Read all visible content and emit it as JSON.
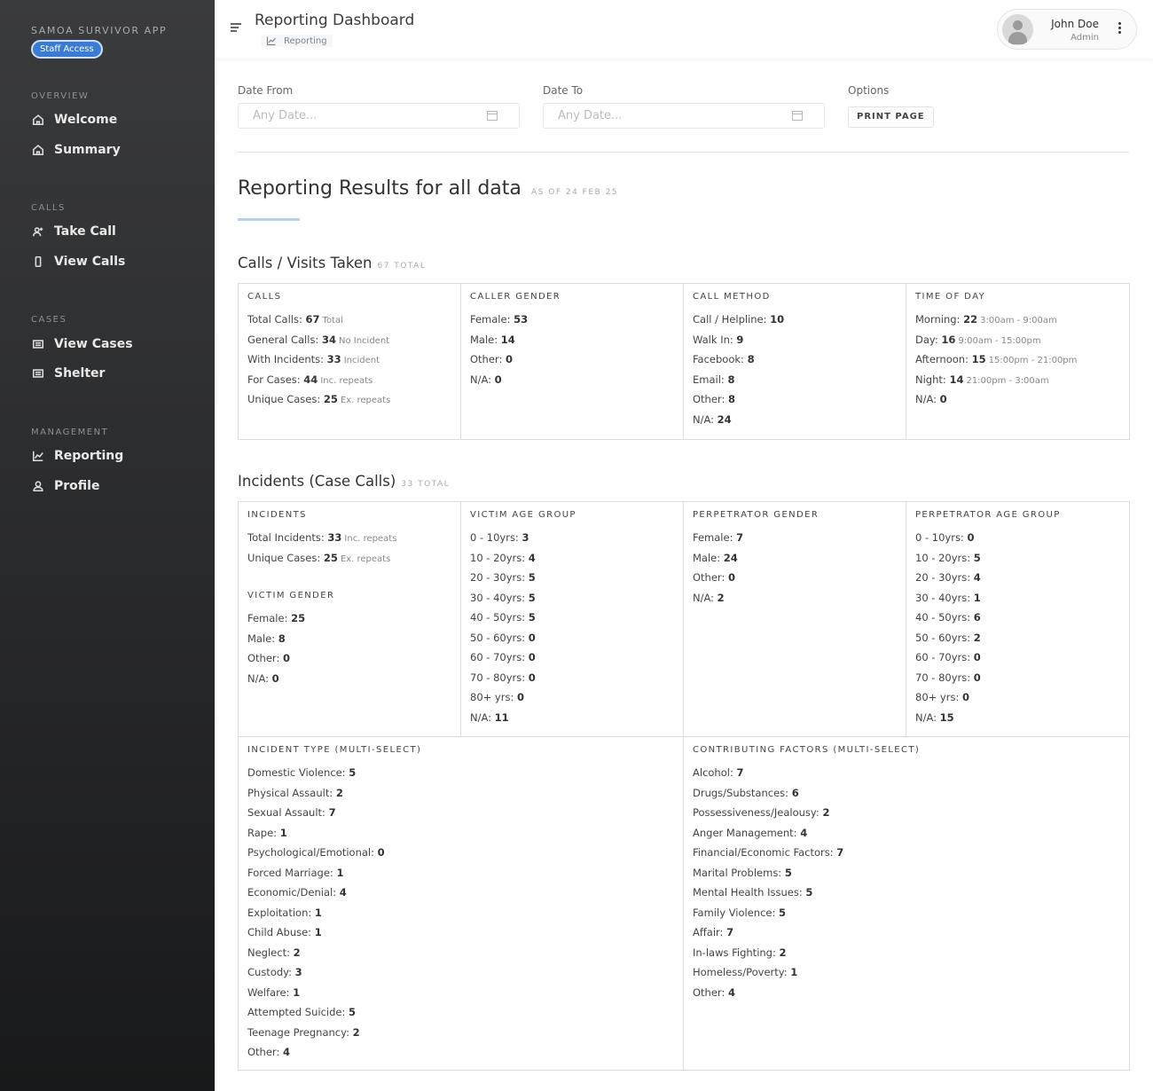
{
  "sidebar": {
    "app_title": "SAMOA SURVIVOR APP",
    "badge": "Staff Access",
    "sections": [
      {
        "label": "OVERVIEW",
        "items": [
          {
            "label": "Welcome",
            "icon": "home-icon"
          },
          {
            "label": "Summary",
            "icon": "home-icon"
          }
        ]
      },
      {
        "label": "CALLS",
        "items": [
          {
            "label": "Take Call",
            "icon": "user-add-icon"
          },
          {
            "label": "View Calls",
            "icon": "phone-icon"
          }
        ]
      },
      {
        "label": "CASES",
        "items": [
          {
            "label": "View Cases",
            "icon": "list-icon"
          },
          {
            "label": "Shelter",
            "icon": "list-icon"
          }
        ]
      },
      {
        "label": "MANAGEMENT",
        "items": [
          {
            "label": "Reporting",
            "icon": "chart-icon"
          },
          {
            "label": "Profile",
            "icon": "user-icon"
          }
        ]
      }
    ]
  },
  "header": {
    "title": "Reporting Dashboard",
    "breadcrumb": "Reporting",
    "user_name": "John Doe",
    "user_role": "Admin"
  },
  "filters": {
    "date_from_label": "Date From",
    "date_to_label": "Date To",
    "options_label": "Options",
    "date_placeholder": "Any Date...",
    "print_label": "PRINT PAGE"
  },
  "results": {
    "title": "Reporting Results for all data",
    "subtitle": "AS OF 24 FEB 25"
  },
  "calls_section": {
    "title": "Calls / Visits Taken",
    "total": "67 TOTAL",
    "columns": [
      {
        "head": "CALLS",
        "rows": [
          {
            "label": "Total Calls: ",
            "value": "67",
            "note": "Total"
          },
          {
            "label": "General Calls: ",
            "value": "34",
            "note": "No Incident"
          },
          {
            "label": "With Incidents: ",
            "value": "33",
            "note": "Incident"
          },
          {
            "label": "For Cases: ",
            "value": "44",
            "note": "Inc. repeats"
          },
          {
            "label": "Unique Cases: ",
            "value": "25",
            "note": "Ex. repeats"
          }
        ]
      },
      {
        "head": "CALLER GENDER",
        "rows": [
          {
            "label": "Female: ",
            "value": "53",
            "note": ""
          },
          {
            "label": "Male: ",
            "value": "14",
            "note": ""
          },
          {
            "label": "Other: ",
            "value": "0",
            "note": ""
          },
          {
            "label": "N/A: ",
            "value": "0",
            "note": ""
          }
        ]
      },
      {
        "head": "CALL METHOD",
        "rows": [
          {
            "label": "Call / Helpline: ",
            "value": "10",
            "note": ""
          },
          {
            "label": "Walk In: ",
            "value": "9",
            "note": ""
          },
          {
            "label": "Facebook: ",
            "value": "8",
            "note": ""
          },
          {
            "label": "Email: ",
            "value": "8",
            "note": ""
          },
          {
            "label": "Other: ",
            "value": "8",
            "note": ""
          },
          {
            "label": "N/A: ",
            "value": "24",
            "note": ""
          }
        ]
      },
      {
        "head": "TIME OF DAY",
        "rows": [
          {
            "label": "Morning: ",
            "value": "22",
            "note": "3:00am - 9:00am"
          },
          {
            "label": "Day: ",
            "value": "16",
            "note": "9:00am - 15:00pm"
          },
          {
            "label": "Afternoon: ",
            "value": "15",
            "note": "15:00pm - 21:00pm"
          },
          {
            "label": "Night: ",
            "value": "14",
            "note": "21:00pm - 3:00am"
          },
          {
            "label": "N/A: ",
            "value": "0",
            "note": ""
          }
        ]
      }
    ]
  },
  "incidents_section": {
    "title": "Incidents (Case Calls)",
    "total": "33 TOTAL",
    "incidents": {
      "head": "INCIDENTS",
      "rows": [
        {
          "label": "Total Incidents: ",
          "value": "33",
          "note": "Inc. repeats"
        },
        {
          "label": "Unique Cases: ",
          "value": "25",
          "note": "Ex. repeats"
        }
      ]
    },
    "victim_gender": {
      "head": "VICTIM GENDER",
      "rows": [
        {
          "label": "Female: ",
          "value": "25",
          "note": ""
        },
        {
          "label": "Male: ",
          "value": "8",
          "note": ""
        },
        {
          "label": "Other: ",
          "value": "0",
          "note": ""
        },
        {
          "label": "N/A: ",
          "value": "0",
          "note": ""
        }
      ]
    },
    "victim_age": {
      "head": "VICTIM AGE GROUP",
      "rows": [
        {
          "label": "0 - 10yrs: ",
          "value": "3",
          "note": ""
        },
        {
          "label": "10 - 20yrs: ",
          "value": "4",
          "note": ""
        },
        {
          "label": "20 - 30yrs: ",
          "value": "5",
          "note": ""
        },
        {
          "label": "30 - 40yrs: ",
          "value": "5",
          "note": ""
        },
        {
          "label": "40 - 50yrs: ",
          "value": "5",
          "note": ""
        },
        {
          "label": "50 - 60yrs: ",
          "value": "0",
          "note": ""
        },
        {
          "label": "60 - 70yrs: ",
          "value": "0",
          "note": ""
        },
        {
          "label": "70 - 80yrs: ",
          "value": "0",
          "note": ""
        },
        {
          "label": "80+ yrs: ",
          "value": "0",
          "note": ""
        },
        {
          "label": "N/A: ",
          "value": "11",
          "note": ""
        }
      ]
    },
    "perp_gender": {
      "head": "PERPETRATOR GENDER",
      "rows": [
        {
          "label": "Female: ",
          "value": "7",
          "note": ""
        },
        {
          "label": "Male: ",
          "value": "24",
          "note": ""
        },
        {
          "label": "Other: ",
          "value": "0",
          "note": ""
        },
        {
          "label": "N/A: ",
          "value": "2",
          "note": ""
        }
      ]
    },
    "perp_age": {
      "head": "PERPETRATOR AGE GROUP",
      "rows": [
        {
          "label": "0 - 10yrs: ",
          "value": "0",
          "note": ""
        },
        {
          "label": "10 - 20yrs: ",
          "value": "5",
          "note": ""
        },
        {
          "label": "20 - 30yrs: ",
          "value": "4",
          "note": ""
        },
        {
          "label": "30 - 40yrs: ",
          "value": "1",
          "note": ""
        },
        {
          "label": "40 - 50yrs: ",
          "value": "6",
          "note": ""
        },
        {
          "label": "50 - 60yrs: ",
          "value": "2",
          "note": ""
        },
        {
          "label": "60 - 70yrs: ",
          "value": "0",
          "note": ""
        },
        {
          "label": "70 - 80yrs: ",
          "value": "0",
          "note": ""
        },
        {
          "label": "80+ yrs: ",
          "value": "0",
          "note": ""
        },
        {
          "label": "N/A: ",
          "value": "15",
          "note": ""
        }
      ]
    },
    "incident_type": {
      "head": "INCIDENT TYPE (MULTI-SELECT)",
      "rows": [
        {
          "label": "Domestic Violence: ",
          "value": "5",
          "note": ""
        },
        {
          "label": "Physical Assault: ",
          "value": "2",
          "note": ""
        },
        {
          "label": "Sexual Assault: ",
          "value": "7",
          "note": ""
        },
        {
          "label": "Rape: ",
          "value": "1",
          "note": ""
        },
        {
          "label": "Psychological/Emotional: ",
          "value": "0",
          "note": ""
        },
        {
          "label": "Forced Marriage: ",
          "value": "1",
          "note": ""
        },
        {
          "label": "Economic/Denial: ",
          "value": "4",
          "note": ""
        },
        {
          "label": "Exploitation: ",
          "value": "1",
          "note": ""
        },
        {
          "label": "Child Abuse: ",
          "value": "1",
          "note": ""
        },
        {
          "label": "Neglect: ",
          "value": "2",
          "note": ""
        },
        {
          "label": "Custody: ",
          "value": "3",
          "note": ""
        },
        {
          "label": "Welfare: ",
          "value": "1",
          "note": ""
        },
        {
          "label": "Attempted Suicide: ",
          "value": "5",
          "note": ""
        },
        {
          "label": "Teenage Pregnancy: ",
          "value": "2",
          "note": ""
        },
        {
          "label": "Other: ",
          "value": "4",
          "note": ""
        }
      ]
    },
    "contributing": {
      "head": "CONTRIBUTING FACTORS (MULTI-SELECT)",
      "rows": [
        {
          "label": "Alcohol: ",
          "value": "7",
          "note": ""
        },
        {
          "label": "Drugs/Substances: ",
          "value": "6",
          "note": ""
        },
        {
          "label": "Possessiveness/Jealousy: ",
          "value": "2",
          "note": ""
        },
        {
          "label": "Anger Management: ",
          "value": "4",
          "note": ""
        },
        {
          "label": "Financial/Economic Factors: ",
          "value": "7",
          "note": ""
        },
        {
          "label": "Marital Problems: ",
          "value": "5",
          "note": ""
        },
        {
          "label": "Mental Health Issues: ",
          "value": "5",
          "note": ""
        },
        {
          "label": "Family Violence: ",
          "value": "5",
          "note": ""
        },
        {
          "label": "Affair: ",
          "value": "7",
          "note": ""
        },
        {
          "label": "In-laws Fighting: ",
          "value": "2",
          "note": ""
        },
        {
          "label": "Homeless/Poverty: ",
          "value": "1",
          "note": ""
        },
        {
          "label": "Other: ",
          "value": "4",
          "note": ""
        }
      ]
    }
  }
}
